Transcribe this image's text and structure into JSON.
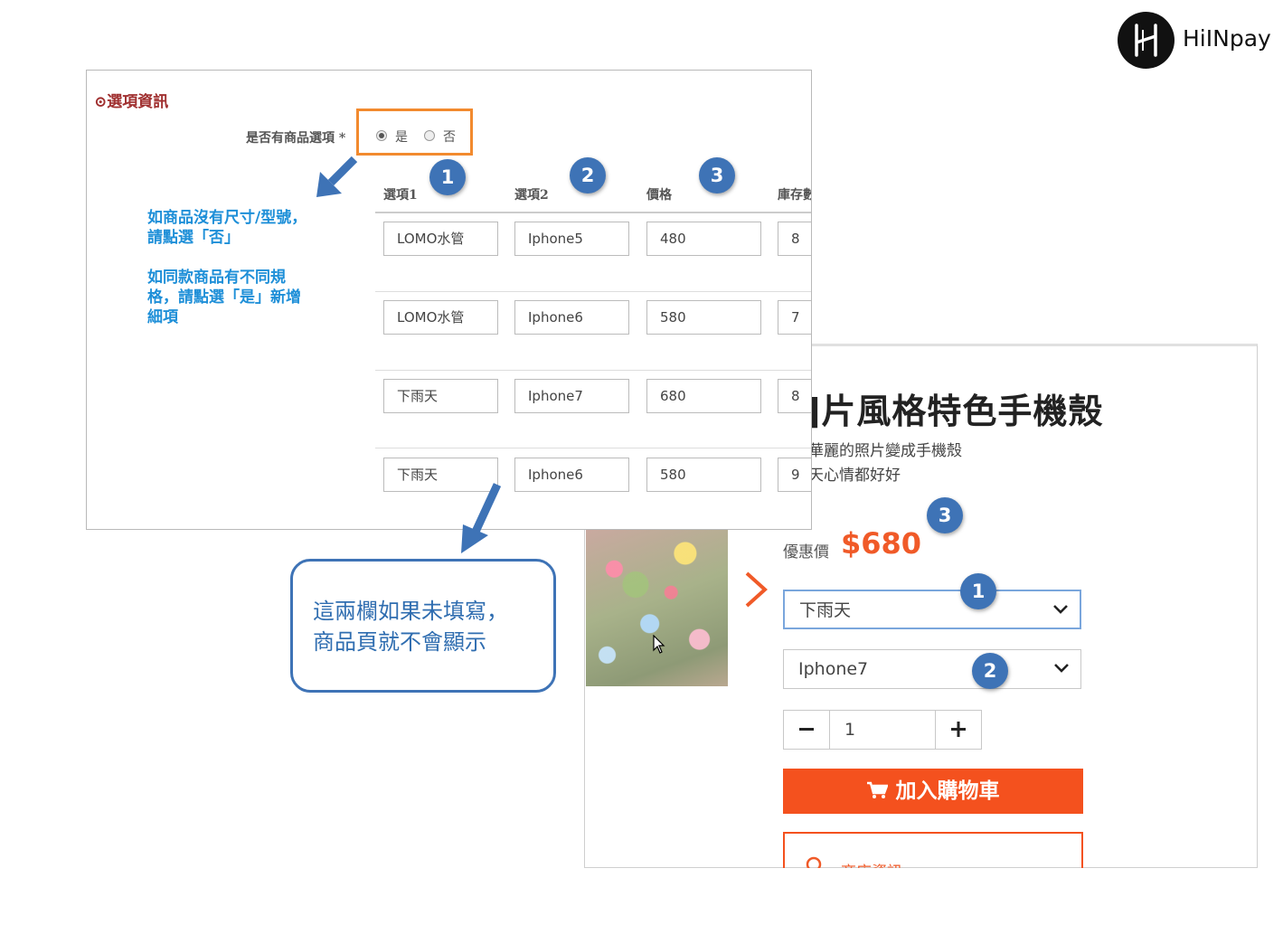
{
  "logo": {
    "brand": "HiINpay"
  },
  "admin": {
    "section_title": "⊙選項資訊",
    "option_question": "是否有商品選項 *",
    "radio": [
      {
        "label": "是",
        "checked": true
      },
      {
        "label": "否",
        "checked": false
      }
    ],
    "columns": [
      "選項1",
      "選項2",
      "價格",
      "庫存數"
    ],
    "rows": [
      {
        "option1": "LOMO水管",
        "option2": "Iphone5",
        "price": "480",
        "stock": "8"
      },
      {
        "option1": "LOMO水管",
        "option2": "Iphone6",
        "price": "580",
        "stock": "7"
      },
      {
        "option1": "下雨天",
        "option2": "Iphone7",
        "price": "680",
        "stock": "8"
      },
      {
        "option1": "下雨天",
        "option2": "Iphone6",
        "price": "580",
        "stock": "9"
      }
    ],
    "hint_line1": "如商品沒有尺寸/型號，",
    "hint_line2": "請點選「否」",
    "hint_line3": "如同款商品有不同規",
    "hint_line4": "格，請點選「是」新增",
    "hint_line5": "細項"
  },
  "badges": {
    "one": "1",
    "two": "2",
    "three": "3"
  },
  "callout": {
    "line1": "這兩欄如果未填寫，",
    "line2": "商品頁就不會顯示"
  },
  "product": {
    "title": "]片風格特色手機殼",
    "desc_line1": "華麗的照片變成手機殼",
    "desc_line2": "天心情都好好",
    "price_label": "優惠價",
    "price_value": "$680",
    "select1_value": "下雨天",
    "select2_value": "Iphone7",
    "quantity": "1",
    "add_to_cart": "加入購物車",
    "store_info": "商店資訊"
  },
  "colors": {
    "accent": "#f05a28",
    "badge": "#3e73b6",
    "hint": "#1e8fd8",
    "highlight": "#f28a2e"
  },
  "icons": [
    "logo-icon",
    "chevron-right-icon",
    "chevron-down-icon",
    "cart-icon",
    "arrow-down-left-icon",
    "arrow-down-icon",
    "cursor-icon",
    "store-icon"
  ]
}
